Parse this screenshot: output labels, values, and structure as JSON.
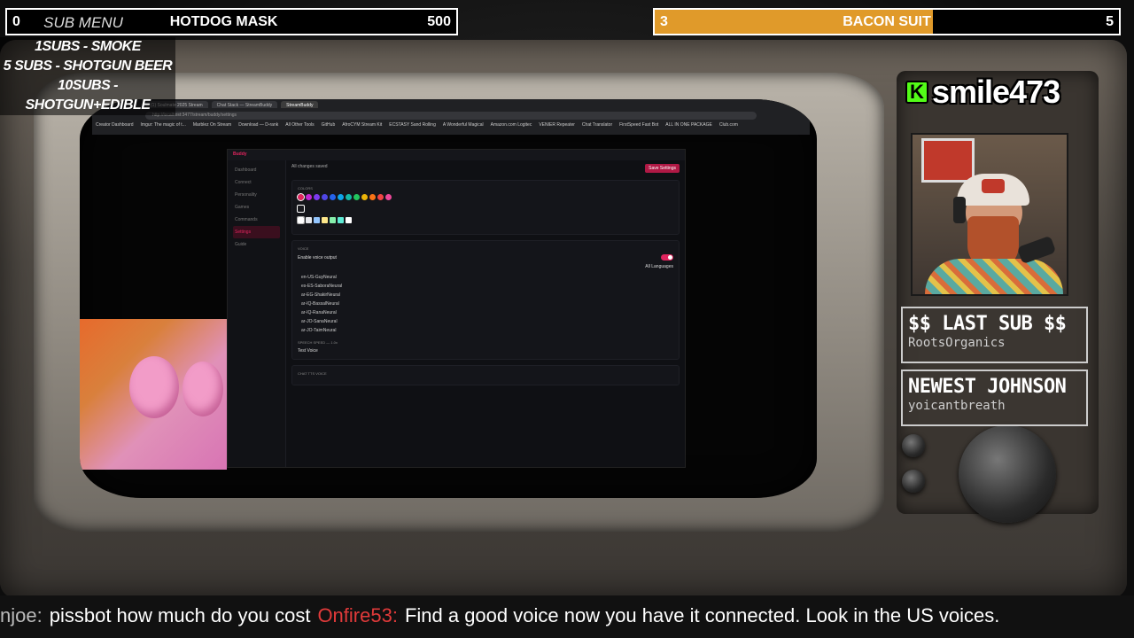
{
  "goals": {
    "left": {
      "count": "0",
      "name": "HOTDOG MASK",
      "target": "500",
      "progress": 0.0
    },
    "right": {
      "count": "3",
      "name": "BACON SUIT",
      "target": "5",
      "progress": 0.6
    }
  },
  "sub_menu": {
    "title": "SUB MENU",
    "items": [
      "1SUBS   - SMOKE",
      "5 SUBS  - SHOTGUN BEER",
      "10SUBS - SHOTGUN+EDIBLE"
    ]
  },
  "streamer": {
    "platform_icon": "K",
    "name": "smile473"
  },
  "last_sub": {
    "label": "$$ LAST SUB $$",
    "value": "RootsOrganics"
  },
  "newest": {
    "label": "NEWEST JOHNSON",
    "value": "yoicantbreath"
  },
  "chat": [
    {
      "user": "njoe:",
      "message": "pissbot how much do you cost",
      "color": "#bbbbbb"
    },
    {
      "user": "Onfire53:",
      "message": "Find a good voice now you have it connected. Look in the US voices.",
      "color": "#e13a3a"
    }
  ],
  "screen_app": {
    "brand": "Buddy",
    "save_label": "Save Settings",
    "status": "All changes saved",
    "nav": [
      "Dashboard",
      "Connect",
      "Personality",
      "Games",
      "Commands",
      "Settings",
      "Guide"
    ],
    "active_nav": "Settings",
    "colors_title": "COLORS",
    "voice_title": "VOICE",
    "enable_voice": "Enable voice output",
    "all_languages": "All Languages",
    "voices": [
      "en-US-GuyNeural",
      "es-ES-SaboraNeural",
      "ar-EG-ShakirNeural",
      "ar-IQ-BassalNeural",
      "ar-IQ-RanaNeural",
      "ar-JO-SanaNeural",
      "ar-JO-TaimNeural"
    ],
    "speech_speed": "SPEECH SPEED — 1.0x",
    "test_voice": "Test Voice",
    "chat_tts": "CHAT TTS VOICE",
    "accent_colors": [
      "#e0245e",
      "#c026d3",
      "#7c3aed",
      "#4f46e5",
      "#2563eb",
      "#0ea5e9",
      "#14b8a6",
      "#22c55e",
      "#eab308",
      "#f97316",
      "#ef4444",
      "#ec4899"
    ]
  },
  "browser": {
    "tabs": [
      "(1) Soulmate 2025 Stream",
      "Chat Stack — StreamBuddy",
      "StreamBuddy"
    ],
    "url": "http://localhost:3477/stream/buddy/settings",
    "bookmarks": [
      "Creator Dashboard",
      "Imgur: The magic of t...",
      "Marblez On Stream",
      "Download — D-rank",
      "All Other Tools",
      "GitHub",
      "AfroCYM Stream Kit",
      "ECSTASY Sand Rolling",
      "A Wonderful Magical",
      "Amazon.com Logitec",
      "VENIER Repeater",
      "Chat Translator",
      "FirstSpeed Fast Bot",
      "ALL IN ONE PACKAGE",
      "Club.com"
    ]
  }
}
